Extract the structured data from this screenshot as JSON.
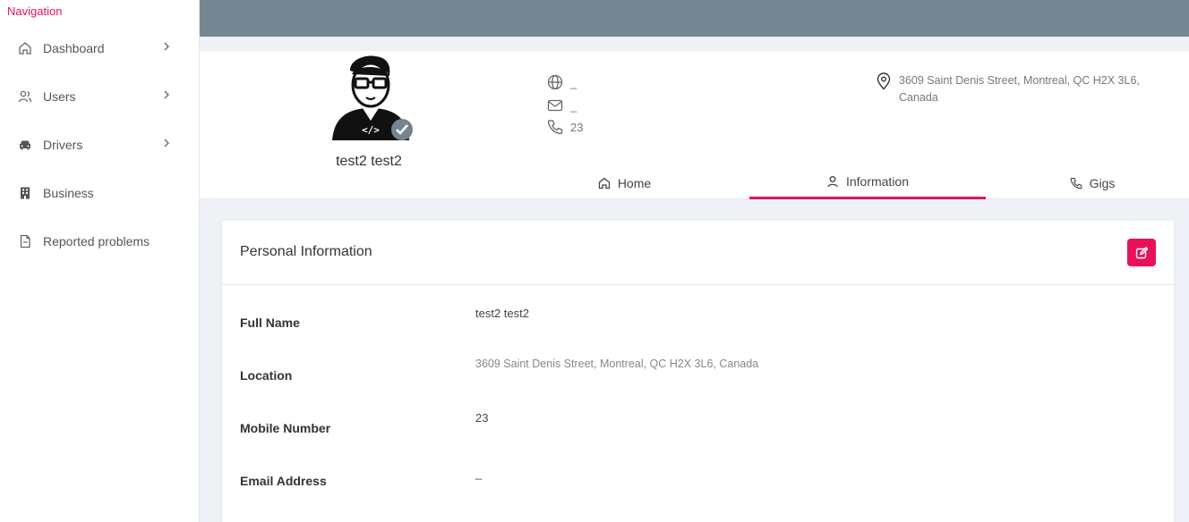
{
  "sidebar": {
    "title": "Navigation",
    "items": [
      {
        "label": "Dashboard",
        "icon": "home-icon",
        "has_chevron": true
      },
      {
        "label": "Users",
        "icon": "users-icon",
        "has_chevron": true
      },
      {
        "label": "Drivers",
        "icon": "car-icon",
        "has_chevron": true
      },
      {
        "label": "Business",
        "icon": "building-icon",
        "has_chevron": false
      },
      {
        "label": "Reported problems",
        "icon": "file-icon",
        "has_chevron": false
      }
    ]
  },
  "profile": {
    "name": "test2 test2",
    "website": "_",
    "email": "_",
    "phone": "23",
    "address": "3609 Saint Denis Street, Montreal, QC H2X 3L6, Canada",
    "verified": true
  },
  "tabs": [
    {
      "label": "Home",
      "icon": "home-icon",
      "active": false
    },
    {
      "label": "Information",
      "icon": "user-icon",
      "active": true
    },
    {
      "label": "Gigs",
      "icon": "phone-icon",
      "active": false
    }
  ],
  "card": {
    "title": "Personal Information",
    "fields": [
      {
        "label": "Full Name",
        "value": "test2 test2"
      },
      {
        "label": "Location",
        "value": "3609 Saint Denis Street, Montreal, QC H2X 3L6, Canada"
      },
      {
        "label": "Mobile Number",
        "value": "23"
      },
      {
        "label": "Email Address",
        "value": "_"
      }
    ]
  },
  "colors": {
    "accent": "#e8125c",
    "topbar": "#748691",
    "background": "#eef1f5"
  }
}
